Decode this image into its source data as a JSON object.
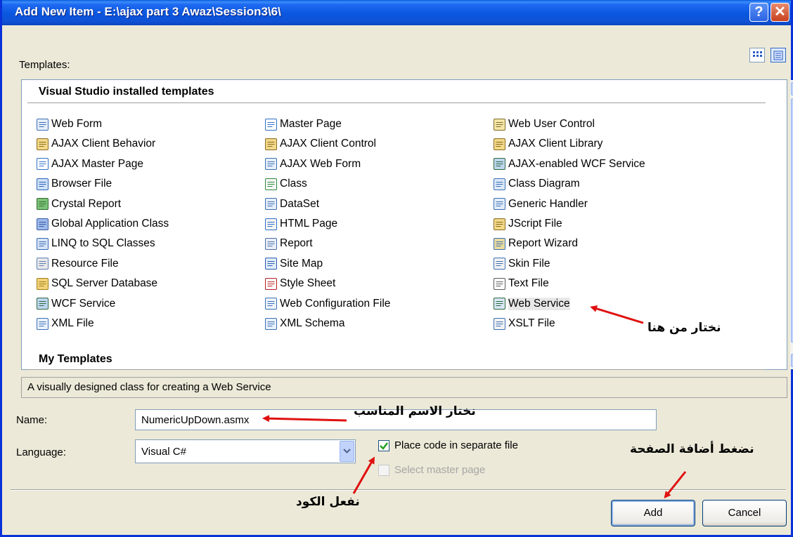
{
  "window": {
    "title": "Add New Item - E:\\ajax part 3 Awaz\\Session3\\6\\",
    "help_glyph": "?",
    "close_glyph": "✕"
  },
  "templates_label": "Templates:",
  "sections": {
    "installed": "Visual Studio installed templates",
    "mine": "My Templates"
  },
  "columns": [
    [
      {
        "label": "Web Form",
        "icon": "web-form-icon"
      },
      {
        "label": "AJAX Client Behavior",
        "icon": "ajax-script-icon"
      },
      {
        "label": "AJAX Master Page",
        "icon": "master-page-icon"
      },
      {
        "label": "Browser File",
        "icon": "browser-file-icon"
      },
      {
        "label": "Crystal Report",
        "icon": "crystal-report-icon"
      },
      {
        "label": "Global Application Class",
        "icon": "global-app-icon"
      },
      {
        "label": "LINQ to SQL Classes",
        "icon": "linq-icon"
      },
      {
        "label": "Resource File",
        "icon": "resource-file-icon"
      },
      {
        "label": "SQL Server Database",
        "icon": "database-icon"
      },
      {
        "label": "WCF Service",
        "icon": "wcf-service-icon"
      },
      {
        "label": "XML File",
        "icon": "xml-file-icon"
      }
    ],
    [
      {
        "label": "Master Page",
        "icon": "master-page-icon"
      },
      {
        "label": "AJAX Client Control",
        "icon": "ajax-script-icon"
      },
      {
        "label": "AJAX Web Form",
        "icon": "web-form-icon"
      },
      {
        "label": "Class",
        "icon": "class-icon"
      },
      {
        "label": "DataSet",
        "icon": "dataset-icon"
      },
      {
        "label": "HTML Page",
        "icon": "html-page-icon"
      },
      {
        "label": "Report",
        "icon": "report-icon"
      },
      {
        "label": "Site Map",
        "icon": "site-map-icon"
      },
      {
        "label": "Style Sheet",
        "icon": "style-sheet-icon"
      },
      {
        "label": "Web Configuration File",
        "icon": "web-config-icon"
      },
      {
        "label": "XML Schema",
        "icon": "xml-schema-icon"
      }
    ],
    [
      {
        "label": "Web User Control",
        "icon": "user-control-icon"
      },
      {
        "label": "AJAX Client Library",
        "icon": "ajax-script-icon"
      },
      {
        "label": "AJAX-enabled WCF Service",
        "icon": "wcf-service-icon"
      },
      {
        "label": "Class Diagram",
        "icon": "class-diagram-icon"
      },
      {
        "label": "Generic Handler",
        "icon": "generic-handler-icon"
      },
      {
        "label": "JScript File",
        "icon": "ajax-script-icon"
      },
      {
        "label": "Report Wizard",
        "icon": "report-wizard-icon"
      },
      {
        "label": "Skin File",
        "icon": "skin-file-icon"
      },
      {
        "label": "Text File",
        "icon": "text-file-icon"
      },
      {
        "label": "Web Service",
        "icon": "web-service-icon"
      },
      {
        "label": "XSLT File",
        "icon": "xslt-file-icon"
      }
    ]
  ],
  "selected_item": "Web Service",
  "description": "A visually designed class for creating a Web Service",
  "name_field": {
    "label": "Name:",
    "value": "NumericUpDown.asmx"
  },
  "language_field": {
    "label": "Language:",
    "value": "Visual C#"
  },
  "checkboxes": {
    "separate_code": {
      "label": "Place code in separate file",
      "checked": true
    },
    "master_page": {
      "label": "Select master page",
      "checked": false,
      "enabled": false
    }
  },
  "buttons": {
    "add": "Add",
    "cancel": "Cancel"
  },
  "annotations": {
    "choose_here": "نختار من هنا",
    "choose_name": "نختار الاسم المناسب",
    "enable_code": "نفعل الكود",
    "press_add": "نضغط أضافة الصفحة"
  },
  "colors": {
    "title_bar": "#0A56DE",
    "dialog_bg": "#ECE9D8",
    "annotation_arrow": "#E01010"
  }
}
